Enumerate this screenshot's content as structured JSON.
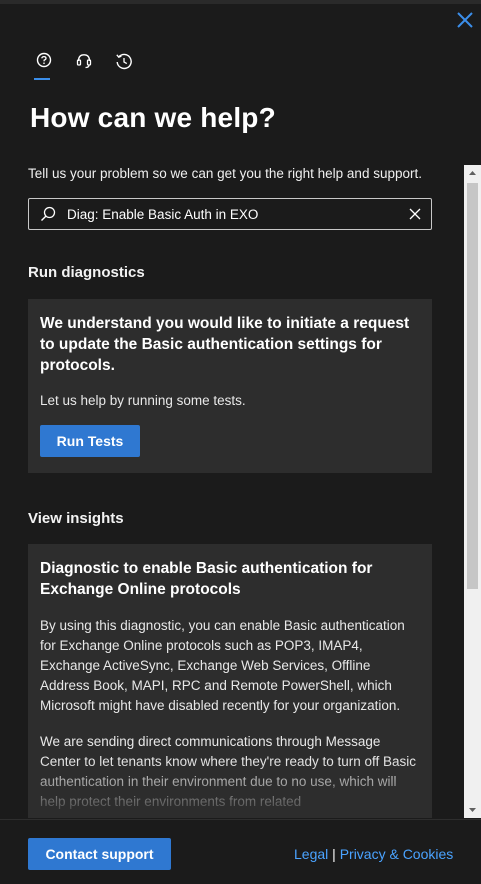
{
  "header": {
    "close_icon": "close-icon",
    "tabs": [
      {
        "icon": "help-icon",
        "active": true
      },
      {
        "icon": "headset-icon",
        "active": false
      },
      {
        "icon": "history-icon",
        "active": false
      }
    ],
    "title": "How can we help?"
  },
  "intro": "Tell us your problem so we can get you the right help and support.",
  "search": {
    "value": "Diag: Enable Basic Auth in EXO"
  },
  "diagnostics": {
    "heading": "Run diagnostics",
    "card_title": "We understand you would like to initiate a request to update the Basic authentication settings for protocols.",
    "card_text": "Let us help by running some tests.",
    "button": "Run Tests"
  },
  "insights": {
    "heading": "View insights",
    "card_title": "Diagnostic to enable Basic authentication for Exchange Online protocols",
    "para1": "By using this diagnostic, you can enable Basic authentication for Exchange Online protocols such as POP3, IMAP4, Exchange ActiveSync, Exchange Web Services, Offline Address Book, MAPI, RPC and Remote PowerShell, which Microsoft might have disabled recently for your organization.",
    "para2": "We are sending direct communications through Message Center to let tenants know where they're ready to turn off Basic authentication in their environment due to no use, which will help protect their environments from related"
  },
  "footer": {
    "contact_button": "Contact support",
    "legal": "Legal",
    "separator": "|",
    "privacy": "Privacy & Cookies"
  },
  "colors": {
    "accent": "#2f78d1",
    "link": "#4aa3ff",
    "background": "#1b1b1b",
    "card": "#2d2d2d"
  }
}
